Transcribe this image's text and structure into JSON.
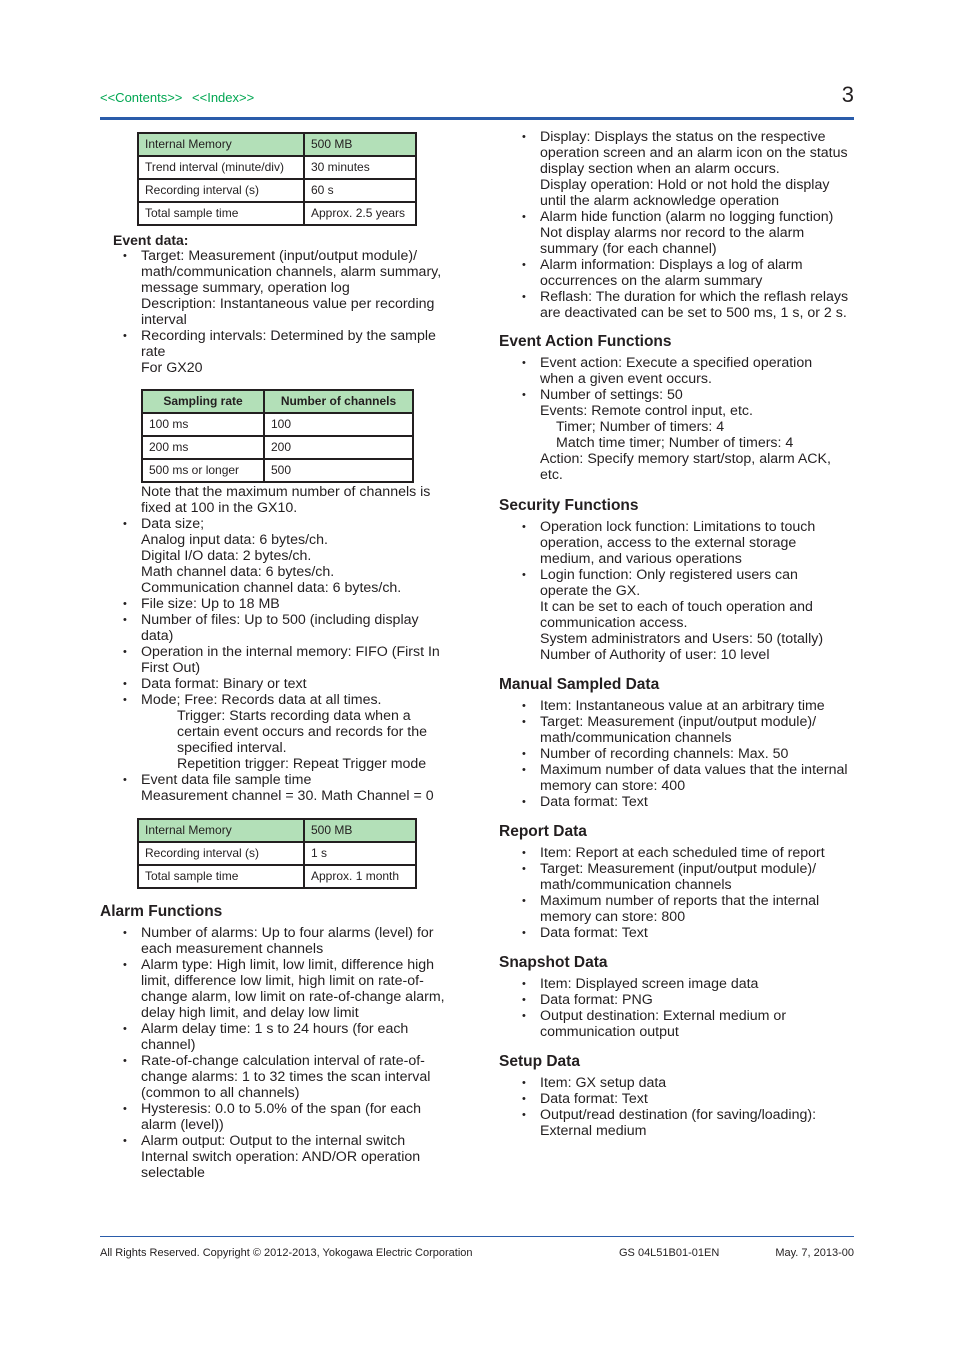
{
  "header": {
    "links": [
      "<<Contents>>",
      "<<Index>>"
    ],
    "page_number": "3",
    "link_color": "#00a651",
    "rule_color": "#2a5caa"
  },
  "table1": {
    "rows": [
      [
        "Internal Memory",
        "500 MB"
      ],
      [
        "Trend interval (minute/div)",
        "30 minutes"
      ],
      [
        "Recording interval (s)",
        "60 s"
      ],
      [
        "Total sample time",
        "Approx. 2.5 years"
      ]
    ]
  },
  "event_data": {
    "title": "Event data:",
    "target": [
      "Target: Measurement (input/output module)/",
      "math/communication channels, alarm summary,",
      "message summary, operation log",
      "Description: Instantaneous value per recording",
      "interval"
    ],
    "recording": [
      "Recording intervals: Determined by the sample",
      "rate",
      "For GX20"
    ]
  },
  "table2": {
    "headers": [
      "Sampling rate",
      "Number of channels"
    ],
    "rows": [
      [
        "100 ms",
        "100"
      ],
      [
        "200 ms",
        "200"
      ],
      [
        "500 ms or longer",
        "500"
      ]
    ]
  },
  "event_data2": {
    "note": [
      "Note that the maximum number of channels is",
      "fixed at 100 in the GX10."
    ],
    "data_size": [
      "Data size;",
      "Analog input data: 6 bytes/ch.",
      "Digital I/O data: 2 bytes/ch.",
      "Math channel data: 6 bytes/ch.",
      "Communication channel data: 6 bytes/ch."
    ],
    "file_size": "File size: Up to 18 MB",
    "num_files": [
      "Number of files: Up to 500 (including display",
      "data)"
    ],
    "operation": [
      "Operation in the internal memory: FIFO (First In",
      "First Out)"
    ],
    "format": "Data format: Binary or text",
    "mode": "Mode; Free: Records data at all times.",
    "mode_sub": [
      "Trigger: Starts recording data when a",
      "certain event occurs and records for the",
      "specified interval.",
      "Repetition trigger: Repeat Trigger mode"
    ],
    "sample_time": [
      "Event data file sample time",
      "Measurement channel = 30. Math Channel = 0"
    ]
  },
  "table3": {
    "rows": [
      [
        "Internal Memory",
        "500 MB"
      ],
      [
        "Recording interval (s)",
        "1 s"
      ],
      [
        "Total sample time",
        "Approx. 1 month"
      ]
    ]
  },
  "alarm": {
    "title": "Alarm Functions",
    "items": [
      [
        "Number of alarms: Up to four alarms (level) for",
        "each measurement channels"
      ],
      [
        "Alarm type: High limit, low limit, difference high",
        "limit, difference low limit, high limit on rate-of-",
        "change alarm, low limit on rate-of-change alarm,",
        "delay high limit, and delay low limit"
      ],
      [
        "Alarm delay time: 1 s to 24 hours (for each",
        "channel)"
      ],
      [
        "Rate-of-change calculation interval of rate-of-",
        "change alarms: 1 to 32 times the scan interval",
        "(common to all channels)"
      ],
      [
        "Hysteresis: 0.0 to 5.0% of the span (for each",
        "alarm (level))"
      ],
      [
        "Alarm output: Output to the internal switch",
        "Internal switch operation: AND/OR operation",
        "selectable"
      ]
    ]
  },
  "alarm_cont": {
    "items": [
      [
        "Display: Displays the status on the respective",
        "operation screen and an alarm icon on the status",
        "display section when an alarm occurs.",
        "Display operation: Hold or not hold the display",
        "until the alarm acknowledge operation"
      ],
      [
        "Alarm hide function (alarm no logging function)",
        "Not display alarms nor record to the alarm",
        "summary (for each channel)"
      ],
      [
        "Alarm information: Displays a log of alarm",
        "occurrences on the alarm summary"
      ],
      [
        "Reflash: The duration for which the reflash relays",
        "are deactivated can be set to 500 ms, 1 s, or 2 s."
      ]
    ]
  },
  "event_action": {
    "title": "Event Action Functions",
    "item1": [
      "Event action: Execute a specified operation",
      "when a given event occurs."
    ],
    "item2": [
      "Number of settings: 50",
      "Events: Remote control input, etc."
    ],
    "item2_sub": [
      "Timer; Number of timers: 4",
      "Match time timer; Number of timers: 4"
    ],
    "item2_end": [
      "Action: Specify memory start/stop, alarm ACK,",
      "etc."
    ]
  },
  "security": {
    "title": "Security Functions",
    "items": [
      [
        "Operation lock function: Limitations to touch",
        "operation, access to the external storage",
        "medium, and various operations"
      ],
      [
        "Login function: Only registered users can",
        "operate the GX.",
        "It can be set to each of touch operation and",
        "communication access.",
        "System administrators and Users: 50 (totally)",
        "Number of Authority of user: 10 level"
      ]
    ]
  },
  "manual": {
    "title": "Manual Sampled Data",
    "items": [
      [
        "Item: Instantaneous value at an arbitrary time"
      ],
      [
        "Target: Measurement (input/output module)/",
        "math/communication channels"
      ],
      [
        "Number of recording channels: Max. 50"
      ],
      [
        "Maximum number of data values that the internal",
        "memory can store: 400"
      ],
      [
        "Data format: Text"
      ]
    ]
  },
  "report": {
    "title": "Report Data",
    "items": [
      [
        "Item: Report at each scheduled time of report"
      ],
      [
        "Target: Measurement (input/output module)/",
        "math/communication channels"
      ],
      [
        "Maximum number of reports that the internal",
        "memory can store: 800"
      ],
      [
        "Data format: Text"
      ]
    ]
  },
  "snapshot": {
    "title": "Snapshot Data",
    "items": [
      [
        "Item: Displayed screen image data"
      ],
      [
        "Data format: PNG"
      ],
      [
        "Output destination: External medium or",
        "communication output"
      ]
    ]
  },
  "setup": {
    "title": "Setup Data",
    "items": [
      [
        "Item: GX setup data"
      ],
      [
        "Data format: Text"
      ],
      [
        "Output/read destination (for saving/loading):",
        "External medium"
      ]
    ]
  },
  "footer": {
    "copyright": "All Rights Reserved. Copyright © 2012-2013, Yokogawa Electric Corporation",
    "doc_id": "GS 04L51B01-01EN",
    "date": "May. 7, 2013-00"
  }
}
